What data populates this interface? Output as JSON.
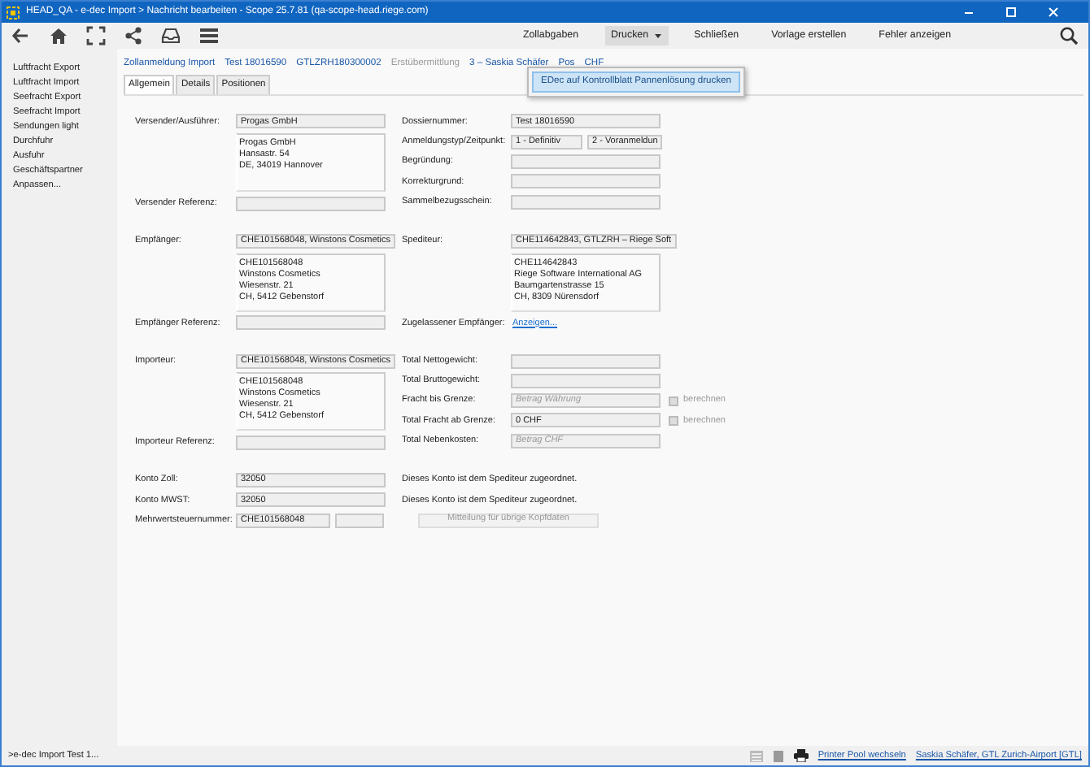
{
  "window": {
    "title": "HEAD_QA - e-dec Import > Nachricht bearbeiten - Scope 25.7.81 (qa-scope-head.riege.com)"
  },
  "toolbar": {
    "menu": [
      {
        "label": "Zollabgaben",
        "dropdown": false,
        "expanded": false
      },
      {
        "label": "Drucken",
        "dropdown": true,
        "expanded": true
      },
      {
        "label": "Schließen",
        "dropdown": false,
        "expanded": false
      },
      {
        "label": "Vorlage erstellen",
        "dropdown": false,
        "expanded": false
      },
      {
        "label": "Fehler anzeigen",
        "dropdown": false,
        "expanded": false
      }
    ],
    "dropdown_items": [
      "EDec auf Kontrollblatt Pannenlösung  drucken"
    ]
  },
  "sidebar": {
    "items": [
      "Luftfracht Export",
      "Luftfracht Import",
      "Seefracht Export",
      "Seefracht Import",
      "Sendungen light",
      "Durchfuhr",
      "Ausfuhr",
      "Geschäftspartner",
      "Anpassen..."
    ]
  },
  "breadcrumb": [
    {
      "label": "Zollanmeldung  Import",
      "disabled": false
    },
    {
      "label": "Test 18016590",
      "disabled": false
    },
    {
      "label": "GTLZRH180300002",
      "disabled": false
    },
    {
      "label": "Erstübermittlung",
      "disabled": true
    },
    {
      "label": "3 – Saskia Schäfer",
      "disabled": false
    },
    {
      "label": "Pos",
      "disabled": false
    },
    {
      "label": "CHF",
      "disabled": false
    }
  ],
  "tabs": [
    {
      "label": "Allgemein",
      "selected": true
    },
    {
      "label": "Details",
      "selected": false
    },
    {
      "label": "Positionen",
      "selected": false
    }
  ],
  "form": {
    "groups": [
      {
        "left": [
          {
            "kind": "field",
            "label": "Versender/Ausführer:",
            "value": "Progas GmbH"
          },
          {
            "kind": "address",
            "lines": [
              "Progas GmbH",
              "Hansastr. 54",
              "DE, 34019 Hannover"
            ]
          },
          {
            "kind": "field",
            "label": "Versender Referenz:"
          }
        ],
        "right": [
          {
            "kind": "field",
            "label": "Dossiernummer:",
            "value": "Test 18016590"
          },
          {
            "kind": "pair",
            "label": "Anmeldungstyp/Zeitpunkt:",
            "values": [
              "1 - Definitiv",
              "2 - Voranmeldun"
            ]
          },
          {
            "kind": "field",
            "label": "Begründung:"
          },
          {
            "kind": "field",
            "label": "Korrekturgrund:"
          },
          {
            "kind": "field",
            "label": "Sammelbezugsschein:"
          }
        ]
      },
      {
        "left": [
          {
            "kind": "field",
            "label": "Empfänger:",
            "value": "CHE101568048, Winstons Cosmetics"
          },
          {
            "kind": "address",
            "lines": [
              "CHE101568048",
              "Winstons Cosmetics",
              "Wiesenstr. 21",
              "CH, 5412 Gebenstorf"
            ]
          },
          {
            "kind": "field",
            "label": "Empfänger Referenz:"
          }
        ],
        "right": [
          {
            "kind": "field",
            "label": "Spediteur:",
            "value": "CHE114642843, GTLZRH – Riege Soft"
          },
          {
            "kind": "address",
            "lines": [
              "CHE114642843",
              "Riege Software International AG",
              "Baumgartenstrasse 15",
              "CH, 8309 Nürensdorf"
            ]
          },
          {
            "kind": "link",
            "label": "Zugelassener Empfänger:",
            "link": "Anzeigen..."
          }
        ]
      },
      {
        "left": [
          {
            "kind": "field",
            "label": "Importeur:",
            "value": "CHE101568048, Winstons Cosmetics"
          },
          {
            "kind": "address",
            "lines": [
              "CHE101568048",
              "Winstons Cosmetics",
              "Wiesenstr. 21",
              "CH, 5412 Gebenstorf"
            ]
          },
          {
            "kind": "field",
            "label": "Importeur Referenz:"
          }
        ],
        "right": [
          {
            "kind": "field",
            "label": "Total Nettogewicht:"
          },
          {
            "kind": "field",
            "label": "Total Bruttogewicht:"
          },
          {
            "kind": "check",
            "label": "Fracht bis Grenze:",
            "placeholder": "Betrag Währung",
            "check_label": "berechnen",
            "checked": false
          },
          {
            "kind": "check",
            "label": "Total Fracht ab Grenze:",
            "value": "0 CHF",
            "check_label": "berechnen",
            "checked": false
          },
          {
            "kind": "field",
            "label": "Total Nebenkosten:",
            "placeholder": "Betrag CHF"
          }
        ]
      },
      {
        "left": [
          {
            "kind": "field",
            "label": "Konto Zoll:",
            "value": "32050"
          },
          {
            "kind": "field",
            "label": "Konto MWST:",
            "value": "32050"
          },
          {
            "kind": "pair",
            "label": "Mehrwertsteuernummer:",
            "values": [
              "CHE101568048"
            ]
          }
        ],
        "right": [
          {
            "kind": "note",
            "text": "Dieses Konto ist dem Spediteur zugeordnet."
          },
          {
            "kind": "note",
            "text": "Dieses Konto ist dem Spediteur zugeordnet."
          },
          {
            "kind": "button",
            "label": "Mitteilung für übrige Kopfdaten"
          }
        ]
      }
    ]
  },
  "status_bar": {
    "task": ">e-dec Import Test 1...",
    "printer": "Printer Pool wechseln",
    "user": "Saskia Schäfer, GTL Zurich-Airport [GTL]"
  }
}
